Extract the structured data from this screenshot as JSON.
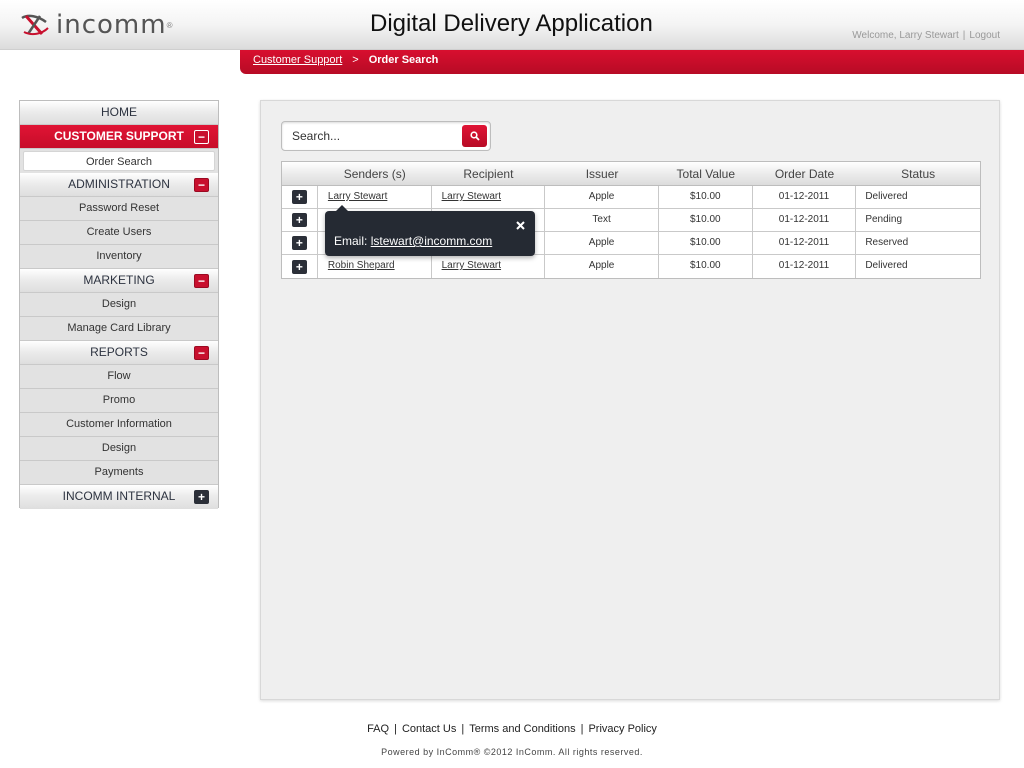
{
  "header": {
    "logo_text": "incomm",
    "logo_reg": "®",
    "title": "Digital Delivery Application",
    "welcome": "Welcome, Larry Stewart",
    "separator": "|",
    "logout": "Logout"
  },
  "breadcrumb": {
    "parent": "Customer Support",
    "separator": ">",
    "current": "Order Search"
  },
  "sidebar": {
    "home": "HOME",
    "customer_support": "CUSTOMER SUPPORT",
    "order_search": "Order Search",
    "administration": "ADMINISTRATION",
    "password_reset": "Password Reset",
    "create_users": "Create Users",
    "inventory": "Inventory",
    "marketing": "MARKETING",
    "marketing_design": "Design",
    "manage_card_library": "Manage Card Library",
    "reports": "REPORTS",
    "flow": "Flow",
    "promo": "Promo",
    "customer_information": "Customer Information",
    "reports_design": "Design",
    "payments": "Payments",
    "incomm_internal": "INCOMM INTERNAL",
    "minus_glyph": "−",
    "plus_glyph": "+"
  },
  "search": {
    "placeholder": "Search..."
  },
  "table": {
    "headers": [
      "Senders (s)",
      "Recipient",
      "Issuer",
      "Total Value",
      "Order Date",
      "Status"
    ],
    "rows": [
      {
        "sender": "Larry Stewart",
        "recipient": "Larry Stewart",
        "issuer": "Apple",
        "value": "$10.00",
        "date": "01-12-2011",
        "status": "Delivered"
      },
      {
        "sender": "",
        "recipient": "",
        "issuer": "Text",
        "value": "$10.00",
        "date": "01-12-2011",
        "status": "Pending"
      },
      {
        "sender": "",
        "recipient": "",
        "issuer": "Apple",
        "value": "$10.00",
        "date": "01-12-2011",
        "status": "Reserved"
      },
      {
        "sender": "Robin Shepard",
        "recipient": "Larry Stewart",
        "issuer": "Apple",
        "value": "$10.00",
        "date": "01-12-2011",
        "status": "Delivered"
      }
    ],
    "expand_glyph": "+"
  },
  "tooltip": {
    "label": "Email:",
    "email": "lstewart@incomm.com"
  },
  "footer": {
    "faq": "FAQ",
    "contact": "Contact Us",
    "terms": "Terms and Conditions",
    "privacy": "Privacy Policy",
    "separator": "|",
    "copyright": "Powered by InComm® ©2012 InComm. All rights reserved."
  },
  "colors": {
    "brand_red": "#c8102e",
    "dark": "#252a33"
  },
  "icons": [
    "incomm-logo-icon",
    "search-icon",
    "minus-icon",
    "plus-icon",
    "close-icon"
  ]
}
